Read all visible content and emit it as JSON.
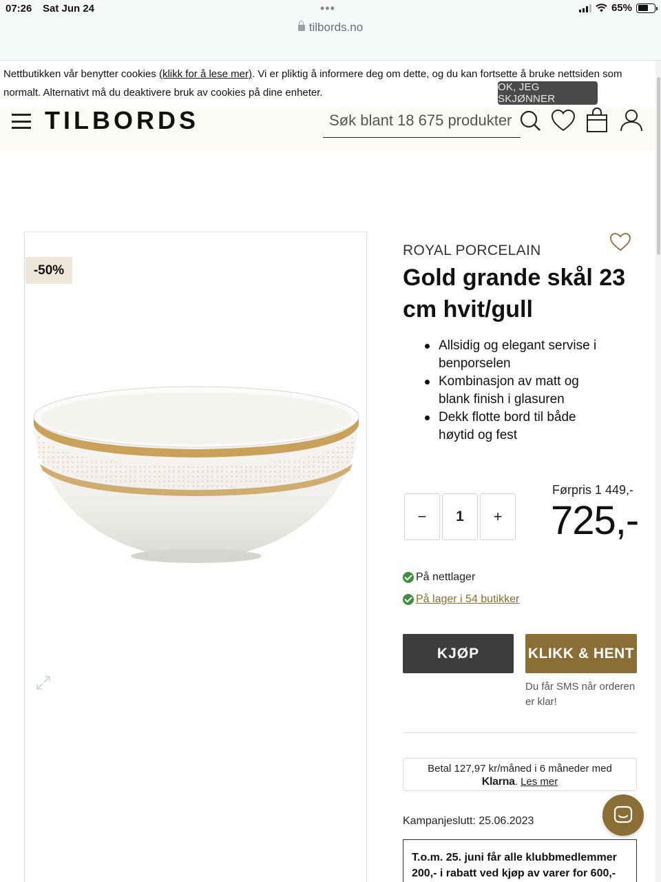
{
  "status_bar": {
    "time": "07:26",
    "date": "Sat Jun 24",
    "battery": "65%"
  },
  "browser": {
    "url": "tilbords.no"
  },
  "cookie_banner": {
    "text_before": "Nettbutikken vår benytter cookies ",
    "link": "(klikk for å lese mer)",
    "text_after": ". Vi er pliktig å informere deg om dette, og du kan fortsette å bruke nettsiden som normalt. Alternativt må du deaktivere bruk av cookies på dine enheter.",
    "accept_label": "OK, JEG SKJØNNER"
  },
  "header": {
    "logo": "TILBORDS",
    "search_placeholder": "Søk blant 18 675 produkter",
    "icons": [
      "menu-icon",
      "search-icon",
      "heart-icon",
      "bag-icon",
      "user-icon"
    ]
  },
  "product": {
    "discount": "-50%",
    "brand": "ROYAL PORCELAIN",
    "title": "Gold grande skål 23 cm hvit/gull",
    "features": [
      "Allsidig og elegant servise i benporselen",
      "Kombinasjon av matt og blank finish i glasuren",
      "Dekk flotte bord til både høytid og fest"
    ],
    "quantity": "1",
    "qty_minus": "−",
    "qty_plus": "+",
    "price_before": "Førpris 1 449,-",
    "price": "725,-",
    "stock_online": "På nettlager",
    "stock_stores": "På lager i 54 butikker",
    "buy_label": "KJØP",
    "click_collect_label": "KLIKK & HENT",
    "sms_note": "Du får SMS når orderen er klar!",
    "klarna_text": "Betal 127,97 kr/måned i 6 måneder med",
    "klarna_brand": "Klarna",
    "klarna_sep": ".",
    "klarna_link": "Les mer",
    "campaign_end": "Kampanjeslutt: 25.06.2023",
    "promo": "T.o.m. 25. juni får alle klubbmedlemmer 200,- i rabatt ved kjøp av varer for 600,-"
  },
  "colors": {
    "accent": "#8b6e36",
    "dark_button": "#3d3d3d",
    "header_bg": "#fdfbf5",
    "badge_bg": "#eee6d8",
    "in_stock": "#3f8f3f"
  }
}
